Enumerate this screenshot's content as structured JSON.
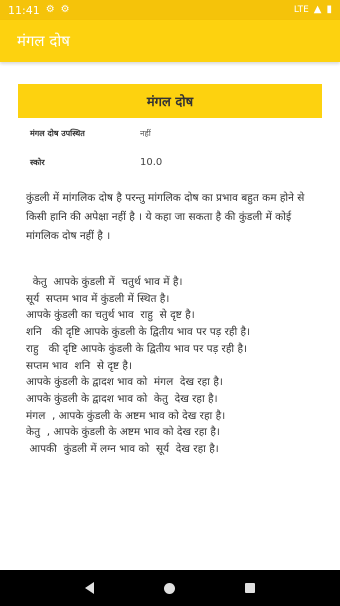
{
  "status_bar": {
    "time": "11:41",
    "icons": [
      "gear-icon",
      "gear-icon"
    ],
    "right_text": "LTE",
    "right_icons": [
      "signal-icon",
      "battery-icon"
    ]
  },
  "app_bar": {
    "title": "मंगल दोष"
  },
  "card": {
    "heading": "मंगल दोष"
  },
  "info": {
    "present_label": "मंगल दोष उपस्थित",
    "present_value": "नहीं",
    "score_label": "स्कोर",
    "score_value": "10.0"
  },
  "description": "कुंडली में मांगलिक दोष है परन्तु मांगलिक दोष का प्रभाव बहुत कम होने से किसी हानि की अपेक्षा नहीं है । ये कहा जा सकता है की कुंडली में कोई मांगलिक दोष नहीं है ।",
  "lines": [
    "  केतु  आपके कुंडली में  चतुर्थ भाव में है।",
    "सूर्य  सप्तम भाव में कुंडली में स्थित है।",
    "आपके कुंडली का चतुर्थ भाव  राहु  से दृष्ट है।",
    "शनि   की दृष्टि आपके कुंडली के द्वितीय भाव पर पड़ रही है।",
    "राहु   की दृष्टि आपके कुंडली के द्वितीय भाव पर पड़ रही है।",
    "सप्तम भाव  शनि  से दृष्ट है।",
    "आपके कुंडली के द्वादश भाव को  मंगल  देख रहा है।",
    "आपके कुंडली के द्वादश भाव को  केतु  देख रहा है।",
    "मंगल  , आपके कुंडली के अष्टम भाव को देख रहा है।",
    "केतु  , आपके कुंडली के अष्टम भाव को देख रहा है।",
    " आपकी  कुंडली में लग्न भाव को  सूर्य  देख रहा है।"
  ],
  "nav": {
    "back_icon": "back-icon",
    "home_icon": "home-icon",
    "recent_icon": "recent-apps-icon"
  }
}
